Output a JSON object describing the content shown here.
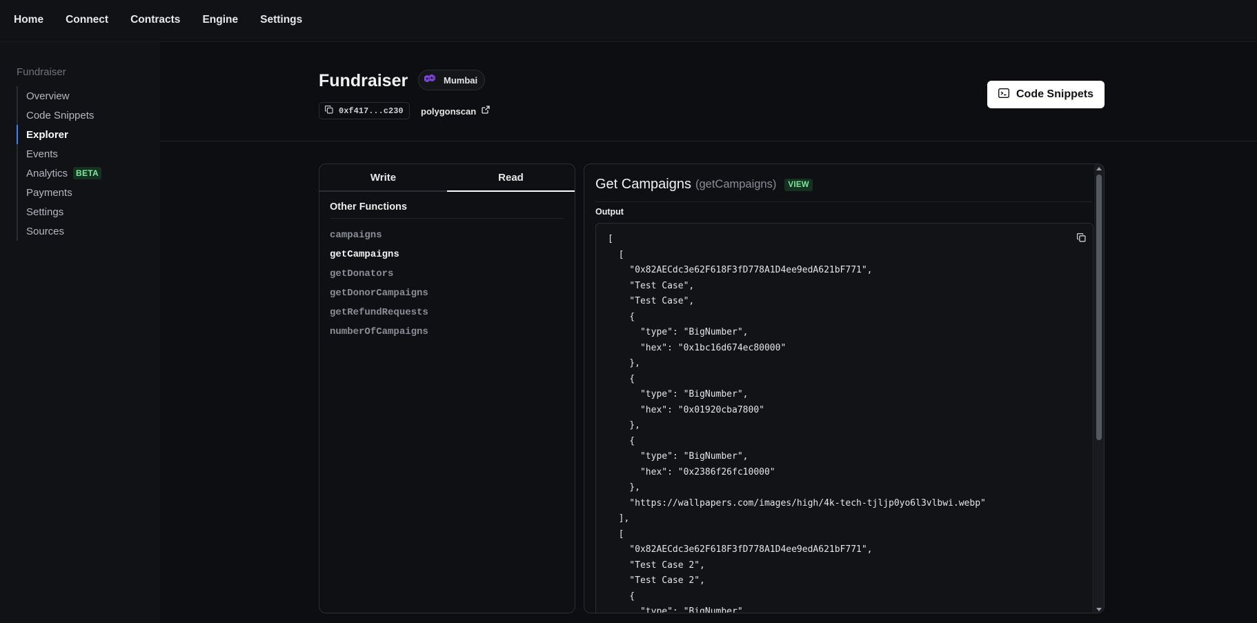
{
  "topnav": {
    "items": [
      "Home",
      "Connect",
      "Contracts",
      "Engine",
      "Settings"
    ]
  },
  "sidebar": {
    "group_title": "Fundraiser",
    "items": [
      {
        "label": "Overview"
      },
      {
        "label": "Code Snippets"
      },
      {
        "label": "Explorer",
        "active": true
      },
      {
        "label": "Events"
      },
      {
        "label": "Analytics",
        "badge": "BETA"
      },
      {
        "label": "Payments"
      },
      {
        "label": "Settings"
      },
      {
        "label": "Sources"
      }
    ]
  },
  "header": {
    "title": "Fundraiser",
    "chain": "Mumbai",
    "address": "0xf417...c230",
    "explorer_link": "polygonscan",
    "snippets_button": "Code Snippets"
  },
  "functions_panel": {
    "tabs": [
      "Write",
      "Read"
    ],
    "active_tab": "Read",
    "section_title": "Other Functions",
    "functions": [
      "campaigns",
      "getCampaigns",
      "getDonators",
      "getDonorCampaigns",
      "getRefundRequests",
      "numberOfCampaigns"
    ],
    "active_function": "getCampaigns"
  },
  "output_panel": {
    "title": "Get Campaigns",
    "signature": "(getCampaigns)",
    "badge": "VIEW",
    "output_label": "Output",
    "code": "[\n  [\n    \"0x82AECdc3e62F618F3fD778A1D4ee9edA621bF771\",\n    \"Test Case\",\n    \"Test Case\",\n    {\n      \"type\": \"BigNumber\",\n      \"hex\": \"0x1bc16d674ec80000\"\n    },\n    {\n      \"type\": \"BigNumber\",\n      \"hex\": \"0x01920cba7800\"\n    },\n    {\n      \"type\": \"BigNumber\",\n      \"hex\": \"0x2386f26fc10000\"\n    },\n    \"https://wallpapers.com/images/high/4k-tech-tjljp0yo6l3vlbwi.webp\"\n  ],\n  [\n    \"0x82AECdc3e62F618F3fD778A1D4ee9edA621bF771\",\n    \"Test Case 2\",\n    \"Test Case 2\",\n    {\n      \"type\": \"BigNumber\","
  },
  "colors": {
    "accent": "#3b82f6",
    "badge_bg": "#14321f",
    "badge_fg": "#7ee8a0",
    "polygon": "#8247e5"
  }
}
